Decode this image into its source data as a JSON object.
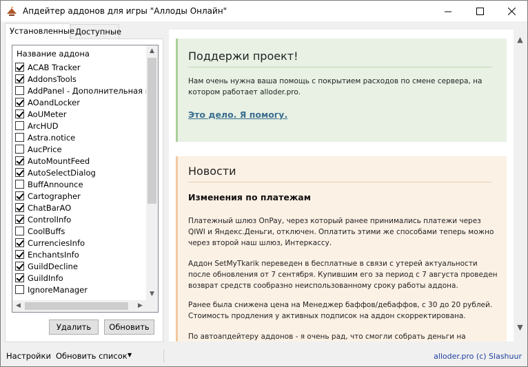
{
  "window": {
    "title": "Апдейтер аддонов для игры \"Аллоды Онлайн\"",
    "controls": {
      "minimize": "—",
      "maximize": "☐",
      "close": "✕"
    }
  },
  "tabs": [
    {
      "label": "Установленные",
      "active": true
    },
    {
      "label": "Доступные",
      "active": false
    }
  ],
  "addon_list": {
    "header": "Название аддона",
    "items": [
      {
        "label": "ACAB Tracker",
        "checked": true
      },
      {
        "label": "AddonsTools",
        "checked": true
      },
      {
        "label": "AddPanel - Дополнительная пан...",
        "checked": false
      },
      {
        "label": "AOandLocker",
        "checked": true
      },
      {
        "label": "AoUMeter",
        "checked": true
      },
      {
        "label": "ArcHUD",
        "checked": false
      },
      {
        "label": "Astra.notice",
        "checked": false
      },
      {
        "label": "AucPrice",
        "checked": false
      },
      {
        "label": "AutoMountFeed",
        "checked": true
      },
      {
        "label": "AutoSelectDialog",
        "checked": true
      },
      {
        "label": "BuffAnnounce",
        "checked": false
      },
      {
        "label": "Cartographer",
        "checked": true
      },
      {
        "label": "ChatBarAO",
        "checked": true
      },
      {
        "label": "ControlInfo",
        "checked": true
      },
      {
        "label": "CoolBuffs",
        "checked": false
      },
      {
        "label": "CurrenciesInfo",
        "checked": true
      },
      {
        "label": "EnchantsInfo",
        "checked": true
      },
      {
        "label": "GuildDecline",
        "checked": true
      },
      {
        "label": "GuildInfo",
        "checked": true
      },
      {
        "label": "IgnoreManager",
        "checked": false
      }
    ]
  },
  "buttons": {
    "delete": "Удалить",
    "update": "Обновить"
  },
  "support": {
    "title": "Поддержи проект!",
    "text": "Нам очень нужна ваша помощь с покрытием расходов по смене сервера, на котором работает allоder.pro.",
    "link": "Это дело. Я помогу."
  },
  "news": {
    "title": "Новости",
    "heading": "Изменения по платежам",
    "paragraphs": [
      "Платежный шлюз OnPay, через который ранее принимались платежи через QIWI и Яндекс.Деньги, отключен. Оплатить этими же способами теперь можно через второй наш шлюз, Интеркассу.",
      "Аддон SetMyTkarik переведен в бесплатные в связи с утерей актуальности после обновления от 7 сентября. Купившим его за период с 7 августа проведен возврат средств сообразно неиспользованному сроку работы аддона.",
      "Ранее была снижена цена на Менеджер баффов/дебаффов, с 30 до 20 рублей. Стоимость продления у активных подписок на аддон скорректирована.",
      "По автоапдейтеру аддонов - я очень рад, что смогли собрать деньги на покупку"
    ]
  },
  "statusbar": {
    "settings": "Настройки",
    "refresh": "Обновить список",
    "credit": "allоder.pro (c) Slashuur"
  },
  "colors": {
    "support_bg": "#e8f1e4",
    "support_border": "#a9cf9a",
    "news_bg": "#fcf1e5",
    "news_border": "#f0c9a0",
    "link": "#3a6e8f",
    "credit": "#1d3fa0"
  }
}
